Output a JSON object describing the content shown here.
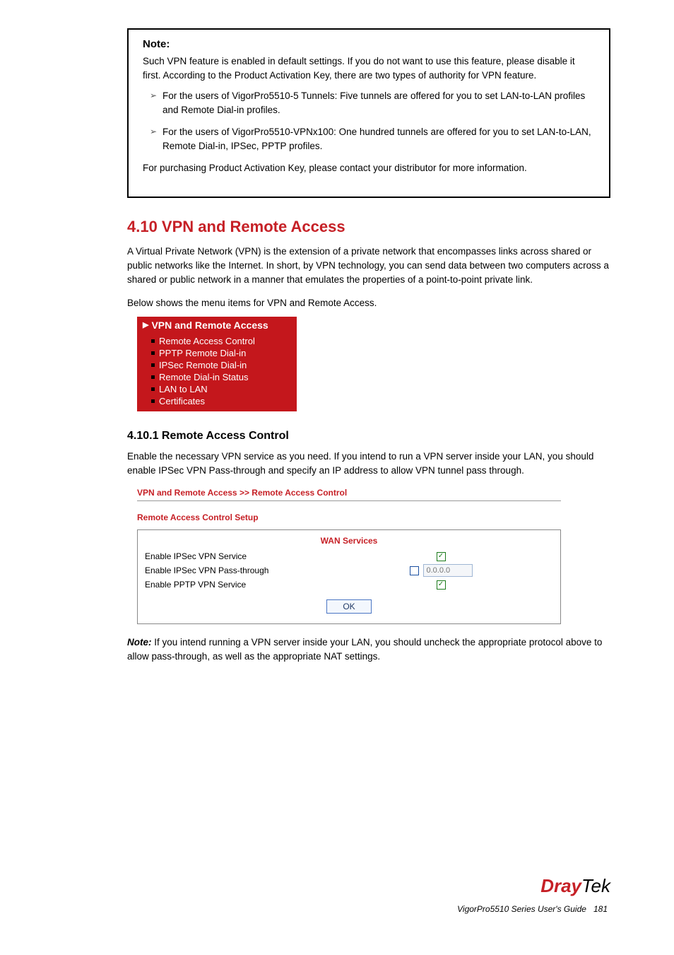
{
  "note_box": {
    "title": "Note:",
    "intro": "Such VPN feature is enabled in default settings. If you do not want to use this feature, please disable it first. According to the Product Activation Key, there are two types of authority for VPN feature.",
    "bullets": [
      "For the users of VigorPro5510-5 Tunnels: Five tunnels are offered for you to set LAN-to-LAN profiles and Remote Dial-in profiles.",
      "For the users of VigorPro5510-VPNx100: One hundred tunnels are offered for you to set LAN-to-LAN, Remote Dial-in, IPSec, PPTP profiles."
    ],
    "trail": "For purchasing Product Activation Key, please contact your distributor for more information."
  },
  "section_title": "4.10 VPN and Remote Access",
  "section_para": "A Virtual Private Network (VPN) is the extension of a private network that encompasses links across shared or public networks like the Internet. In short, by VPN technology, you can send data between two computers across a shared or public network in a manner that emulates the properties of a point-to-point private link.",
  "below_shows": "Below shows the menu items for VPN and Remote Access.",
  "nav": {
    "header": "VPN and Remote Access",
    "items": [
      "Remote Access Control",
      "PPTP Remote Dial-in",
      "IPSec Remote Dial-in",
      "Remote Dial-in Status",
      "LAN to LAN",
      "Certificates"
    ]
  },
  "sub_title": "4.10.1 Remote Access Control",
  "sub_para": "Enable the necessary VPN service as you need. If you intend to run a VPN server inside your LAN, you should enable IPSec VPN Pass-through and specify an IP address to allow VPN tunnel pass through.",
  "rac": {
    "breadcrumb": "VPN and Remote Access >> Remote Access Control",
    "title": "Remote Access Control Setup",
    "wan_header": "WAN Services",
    "rows": {
      "ipsec_label": "Enable IPSec VPN Service",
      "passthrough_label": "Enable IPSec VPN Pass-through",
      "pptp_label": "Enable PPTP VPN Service",
      "ip_placeholder": "0.0.0.0"
    },
    "ok_label": "OK"
  },
  "bottom_note": {
    "label": "Note:",
    "text": "If you intend running a VPN server inside your LAN, you should uncheck the appropriate protocol above to allow pass-through, as well as the appropriate NAT settings."
  },
  "branding": {
    "part1": "Dray",
    "part2": "Tek"
  },
  "page_footer": "VigorPro5510 Series User's Guide",
  "page_number": "181"
}
